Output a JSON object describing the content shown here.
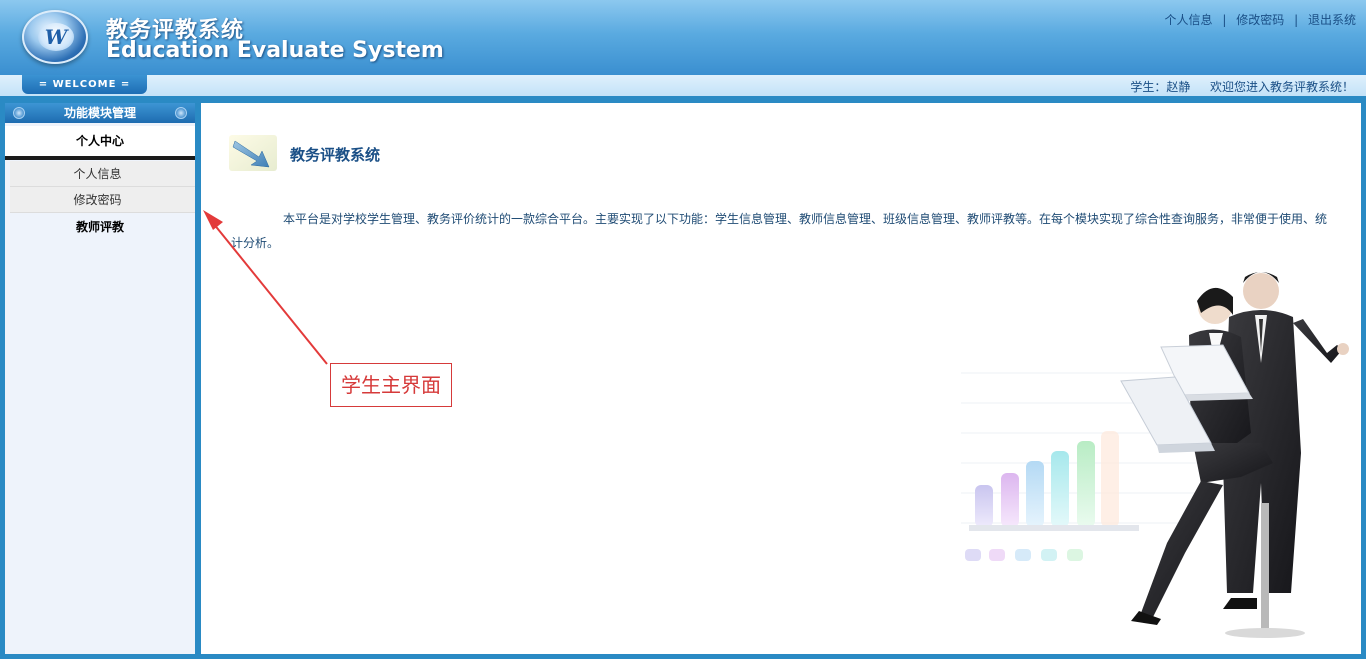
{
  "header": {
    "logo_letter": "W",
    "title_cn": "教务评教系统",
    "title_en": "Education Evaluate System",
    "links": [
      "个人信息",
      "修改密码",
      "退出系统"
    ],
    "link_separator": "|"
  },
  "welcome": {
    "tab_label": "= WELCOME =",
    "user_label": "学生：赵静",
    "greeting": "欢迎您进入教务评教系统！"
  },
  "sidebar": {
    "heading": "功能模块管理",
    "group1": "个人中心",
    "group1_items": [
      "个人信息",
      "修改密码"
    ],
    "group2": "教师评教"
  },
  "main": {
    "title": "教务评教系统",
    "description": "本平台是对学校学生管理、教务评价统计的一款综合平台。主要实现了以下功能：学生信息管理、教师信息管理、班级信息管理、教师评教等。在每个模块实现了综合性查询服务，非常便于使用、统计分析。"
  },
  "annotation": {
    "label": "学生主界面"
  },
  "colors": {
    "header_blue": "#3a8fd0",
    "frame_blue": "#2a8ac4",
    "text_blue": "#1a4f86",
    "annotation_red": "#d63a3a"
  }
}
